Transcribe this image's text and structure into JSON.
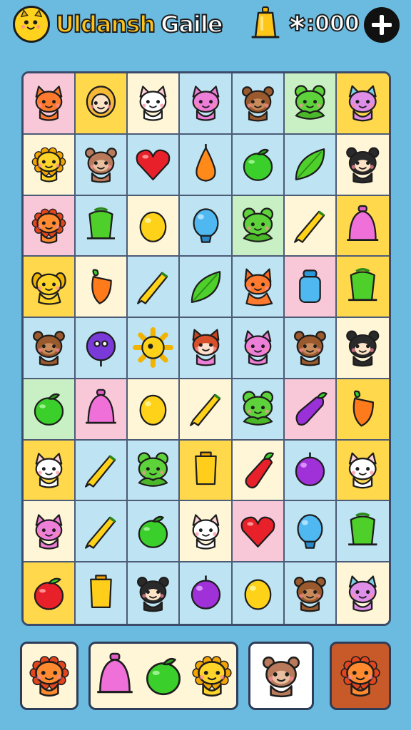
{
  "header": {
    "title_part1": "Uldansh",
    "title_part2": "Gaile",
    "coins": "✱:000",
    "add_button_label": "+",
    "avatar_icon": "yellow-pet-face-icon",
    "bell_icon": "bell-icon"
  },
  "colors": {
    "background": "#6BBBE0",
    "cell_pink": "#F8C7D8",
    "cell_yellow": "#FFD84C",
    "cell_cream": "#FFF6D8",
    "cell_blue": "#BEE3F2",
    "cell_green": "#C9EFC4"
  },
  "board": {
    "rows": 9,
    "cols": 7,
    "tiles": [
      [
        {
          "item": "orange-cat",
          "bg": "pink"
        },
        {
          "item": "blonde-girl",
          "bg": "yellow"
        },
        {
          "item": "white-cat",
          "bg": "cream"
        },
        {
          "item": "pink-cat",
          "bg": "blue"
        },
        {
          "item": "brown-bear",
          "bg": "blue"
        },
        {
          "item": "green-frog",
          "bg": "green"
        },
        {
          "item": "purple-cat",
          "bg": "yellow"
        }
      ],
      [
        {
          "item": "yellow-lion",
          "bg": "cream"
        },
        {
          "item": "brown-monkey",
          "bg": "blue"
        },
        {
          "item": "red-heart",
          "bg": "blue"
        },
        {
          "item": "orange-pear",
          "bg": "blue"
        },
        {
          "item": "green-apple",
          "bg": "blue"
        },
        {
          "item": "green-leaf",
          "bg": "blue"
        },
        {
          "item": "black-bear",
          "bg": "cream"
        }
      ],
      [
        {
          "item": "orange-lion",
          "bg": "pink"
        },
        {
          "item": "green-cup",
          "bg": "blue"
        },
        {
          "item": "yellow-lemon",
          "bg": "cream"
        },
        {
          "item": "blue-balloon",
          "bg": "blue"
        },
        {
          "item": "green-frog",
          "bg": "green"
        },
        {
          "item": "yellow-pencil",
          "bg": "cream"
        },
        {
          "item": "pink-bell",
          "bg": "yellow"
        }
      ],
      [
        {
          "item": "yellow-dog",
          "bg": "yellow"
        },
        {
          "item": "orange-carrot",
          "bg": "cream"
        },
        {
          "item": "yellow-pencil",
          "bg": "blue"
        },
        {
          "item": "green-leaf",
          "bg": "blue"
        },
        {
          "item": "orange-fox",
          "bg": "blue"
        },
        {
          "item": "blue-bottle",
          "bg": "pink"
        },
        {
          "item": "green-cup",
          "bg": "yellow"
        }
      ],
      [
        {
          "item": "brown-bear",
          "bg": "blue"
        },
        {
          "item": "purple-ball",
          "bg": "blue"
        },
        {
          "item": "yellow-sun",
          "bg": "blue"
        },
        {
          "item": "red-squirrel",
          "bg": "blue"
        },
        {
          "item": "pink-cat",
          "bg": "blue"
        },
        {
          "item": "brown-bear",
          "bg": "blue"
        },
        {
          "item": "black-bear",
          "bg": "cream"
        }
      ],
      [
        {
          "item": "green-apple",
          "bg": "green"
        },
        {
          "item": "pink-bell",
          "bg": "pink"
        },
        {
          "item": "yellow-lemon",
          "bg": "cream"
        },
        {
          "item": "yellow-pencil",
          "bg": "cream"
        },
        {
          "item": "green-frog",
          "bg": "blue"
        },
        {
          "item": "purple-eggplant",
          "bg": "pink"
        },
        {
          "item": "orange-carrot",
          "bg": "yellow"
        }
      ],
      [
        {
          "item": "white-cat",
          "bg": "yellow"
        },
        {
          "item": "yellow-pencil",
          "bg": "blue"
        },
        {
          "item": "green-frog",
          "bg": "blue"
        },
        {
          "item": "yellow-cup",
          "bg": "yellow"
        },
        {
          "item": "red-pepper",
          "bg": "cream"
        },
        {
          "item": "purple-plum",
          "bg": "blue"
        },
        {
          "item": "white-cat",
          "bg": "yellow"
        }
      ],
      [
        {
          "item": "pink-cat",
          "bg": "cream"
        },
        {
          "item": "yellow-pencil",
          "bg": "blue"
        },
        {
          "item": "green-apple",
          "bg": "blue"
        },
        {
          "item": "white-cat",
          "bg": "cream"
        },
        {
          "item": "red-heart",
          "bg": "pink"
        },
        {
          "item": "blue-balloon",
          "bg": "blue"
        },
        {
          "item": "green-cup",
          "bg": "blue"
        }
      ],
      [
        {
          "item": "red-apple",
          "bg": "yellow"
        },
        {
          "item": "yellow-cup",
          "bg": "blue"
        },
        {
          "item": "black-bear",
          "bg": "blue"
        },
        {
          "item": "purple-plum",
          "bg": "blue"
        },
        {
          "item": "yellow-lemon",
          "bg": "blue"
        },
        {
          "item": "brown-bear",
          "bg": "blue"
        },
        {
          "item": "purple-cat",
          "bg": "cream"
        }
      ]
    ]
  },
  "tray": [
    {
      "name": "tray-slot-1",
      "bg": "cream",
      "items": [
        "orange-lion"
      ]
    },
    {
      "name": "tray-slot-2",
      "bg": "cream",
      "items": [
        "pink-bell",
        "green-apple",
        "yellow-lion"
      ]
    },
    {
      "name": "tray-slot-3",
      "bg": "white",
      "items": [
        "brown-monkey"
      ]
    },
    {
      "name": "tray-slot-4",
      "bg": "rust",
      "items": [
        "orange-lion"
      ]
    }
  ]
}
